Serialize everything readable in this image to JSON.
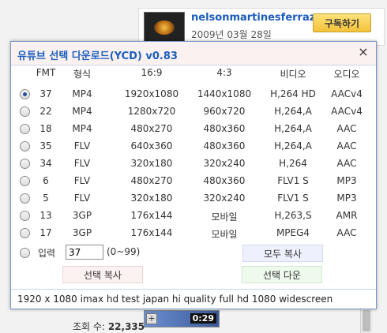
{
  "background": {
    "channel_name": "nelsonmartinesferraz",
    "channel_date": "2009년 03월 28일",
    "subscribe_label": "구독하기",
    "views_label": "조회 수:",
    "views_count": "22,335",
    "duration": "0:29",
    "plus": "+"
  },
  "dialog": {
    "title": "유튜브 선택 다운로드(YCD) v0.83",
    "close": "×",
    "headers": {
      "fmt": "FMT",
      "type": "형식",
      "res_169": "16:9",
      "res_43": "4:3",
      "video": "비디오",
      "audio": "오디오"
    },
    "rows": [
      {
        "fmt": "37",
        "type": "MP4",
        "res_169": "1920x1080",
        "res_43": "1440x1080",
        "video": "H,264 HD",
        "audio": "AACv4",
        "selected": true
      },
      {
        "fmt": "22",
        "type": "MP4",
        "res_169": "1280x720",
        "res_43": "960x720",
        "video": "H,264,A",
        "audio": "AACv4",
        "selected": false
      },
      {
        "fmt": "18",
        "type": "MP4",
        "res_169": "480x270",
        "res_43": "480x360",
        "video": "H,264,A",
        "audio": "AAC",
        "selected": false
      },
      {
        "fmt": "35",
        "type": "FLV",
        "res_169": "640x360",
        "res_43": "480x360",
        "video": "H,264,A",
        "audio": "AAC",
        "selected": false
      },
      {
        "fmt": "34",
        "type": "FLV",
        "res_169": "320x180",
        "res_43": "320x240",
        "video": "H,264",
        "audio": "AAC",
        "selected": false
      },
      {
        "fmt": "6",
        "type": "FLV",
        "res_169": "480x270",
        "res_43": "480x360",
        "video": "FLV1 S",
        "audio": "MP3",
        "selected": false
      },
      {
        "fmt": "5",
        "type": "FLV",
        "res_169": "320x180",
        "res_43": "320x240",
        "video": "FLV1 S",
        "audio": "MP3",
        "selected": false
      },
      {
        "fmt": "13",
        "type": "3GP",
        "res_169": "176x144",
        "res_43": "모바일",
        "video": "H,263,S",
        "audio": "AMR",
        "selected": false
      },
      {
        "fmt": "17",
        "type": "3GP",
        "res_169": "176x144",
        "res_43": "모바일",
        "video": "MPEG4",
        "audio": "AAC",
        "selected": false
      }
    ],
    "input_label": "입력",
    "input_value": "37",
    "input_range": "(0~99)",
    "copy_all_label": "모두 복사",
    "copy_selected_label": "선택 복사",
    "download_label": "선택 다운",
    "status_text": "1920 x 1080 imax hd test japan hi quality full hd 1080 widescreen"
  }
}
